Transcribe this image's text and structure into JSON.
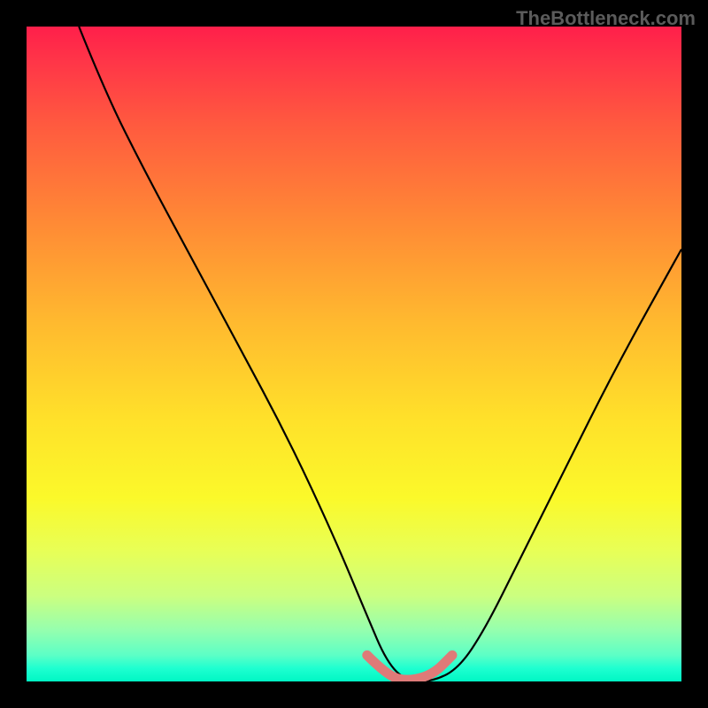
{
  "watermark": "TheBottleneck.com",
  "chart_data": {
    "type": "line",
    "title": "",
    "xlabel": "",
    "ylabel": "",
    "xlim": [
      0,
      100
    ],
    "ylim": [
      0,
      100
    ],
    "background": {
      "type": "vertical-gradient",
      "meaning": "bottleneck severity (red=high, green=low)",
      "stops": [
        {
          "pos": 0,
          "color": "#ff1f4a"
        },
        {
          "pos": 15,
          "color": "#ff5a3f"
        },
        {
          "pos": 45,
          "color": "#ffb92f"
        },
        {
          "pos": 72,
          "color": "#fbf92a"
        },
        {
          "pos": 92,
          "color": "#97ffad"
        },
        {
          "pos": 100,
          "color": "#00f7c4"
        }
      ]
    },
    "series": [
      {
        "name": "bottleneck-curve",
        "color": "#000000",
        "x": [
          8,
          12,
          18,
          25,
          32,
          40,
          47,
          52,
          55,
          58,
          62,
          66,
          70,
          75,
          82,
          90,
          100
        ],
        "values": [
          100,
          90,
          78,
          65,
          52,
          37,
          22,
          10,
          3,
          0,
          0,
          2,
          8,
          18,
          32,
          48,
          66
        ]
      },
      {
        "name": "optimal-range-highlight",
        "color": "#df7a78",
        "x": [
          52,
          55,
          58,
          62,
          65
        ],
        "values": [
          4,
          1,
          0,
          1,
          4
        ]
      }
    ],
    "annotations": []
  }
}
